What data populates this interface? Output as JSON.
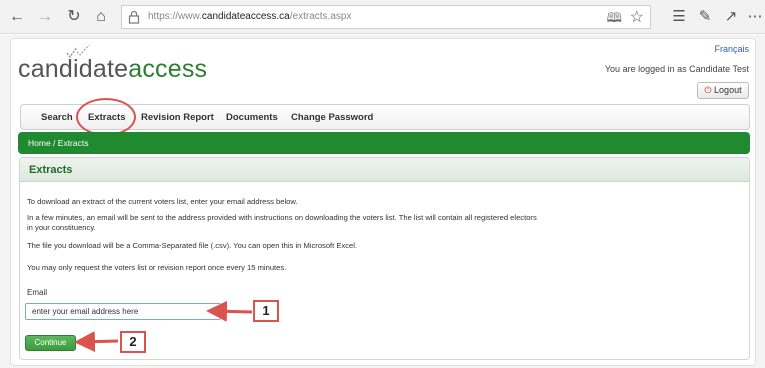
{
  "browser": {
    "url_prefix": "https://www.",
    "url_domain": "candidateaccess.ca",
    "url_path": "/extracts.aspx"
  },
  "site": {
    "logo_part1": "candidate",
    "logo_part2": "access",
    "language_link": "Français",
    "login_status": "You are logged in as Candidate Test",
    "logout_label": "Logout"
  },
  "menu": {
    "items": [
      "Search",
      "Extracts",
      "Revision Report",
      "Documents",
      "Change Password"
    ]
  },
  "breadcrumb": {
    "home": "Home",
    "separator": " / ",
    "current": "Extracts"
  },
  "panel": {
    "title": "Extracts",
    "paragraphs": [
      "To download an extract of the current voters list, enter your email address below.",
      "In a few minutes, an email will be sent to the address provided with instructions on downloading the voters list. The list will contain all registered electors",
      "in your constituency.",
      "The file you download will be a Comma-Separated file (.csv). You can open this in Microsoft Excel.",
      "You may only request the voters list or revision report once every 15 minutes."
    ],
    "email_label": "Email",
    "email_value": "enter your email address here",
    "continue_label": "Continue"
  },
  "annotations": {
    "callout_1": "1",
    "callout_2": "2",
    "color": "#d9534f"
  },
  "colors": {
    "brand_green": "#1f8a2f",
    "link_blue": "#2a5db0"
  }
}
